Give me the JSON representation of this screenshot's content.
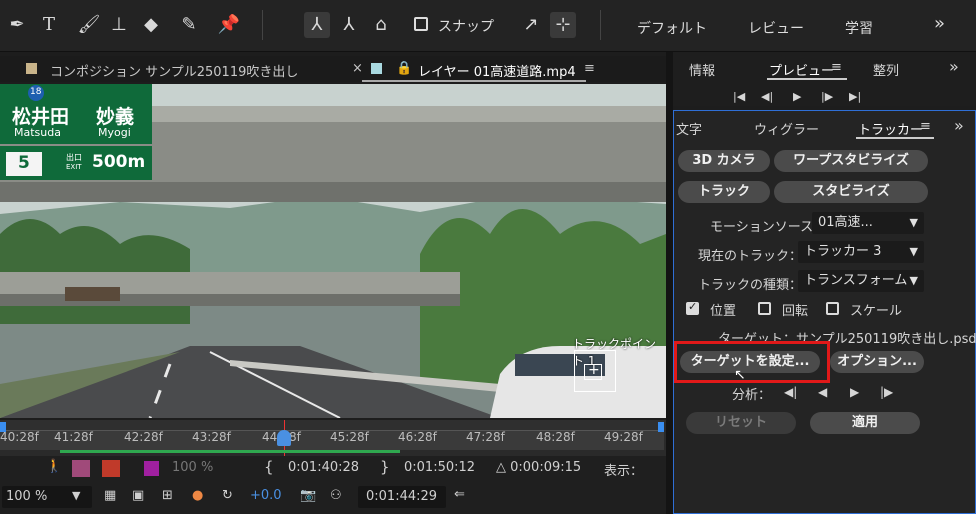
{
  "toolbar": {
    "snap_label": "スナップ",
    "workspaces": [
      "デフォルト",
      "レビュー",
      "学習"
    ],
    "more": "»"
  },
  "comp_panel": {
    "tab1": "コンポジション サンプル250119吹き出し",
    "tab1_close": "×",
    "tab2": "レイヤー 01高速道路.mp4",
    "menu": "≡"
  },
  "viewer": {
    "sign_route": "18",
    "sign_place1": "松井田",
    "sign_place2": "妙義",
    "sign_roman1": "Matsuda",
    "sign_roman2": "Myogi",
    "exit_num": "5",
    "exit_jp": "出口",
    "exit_en": "EXIT",
    "exit_dist": "500m",
    "track_point_label": "トラックポイント 1"
  },
  "timeline": {
    "ticks": [
      "40:28f",
      "41:28f",
      "42:28f",
      "43:28f",
      "44:28f",
      "45:28f",
      "46:28f",
      "47:28f",
      "48:28f",
      "49:28f"
    ]
  },
  "bottom": {
    "opacity": "100 %",
    "in_time": "0:01:40:28",
    "out_time": "0:01:50:12",
    "duration": "△ 0:00:09:15",
    "view_label": "表示：",
    "zoom": "100 %",
    "exposure": "+0.0",
    "current_time": "0:01:44:29"
  },
  "right_top": {
    "tabs": [
      "情報",
      "プレビュー",
      "整列"
    ],
    "menu": "≡"
  },
  "tracker": {
    "tabs": [
      "文字",
      "ウィグラー",
      "トラッカー"
    ],
    "menu": "≡",
    "btn_3d_camera": "3D カメラ",
    "btn_warp": "ワープスタビライズ",
    "btn_track": "トラック",
    "btn_stabilize": "スタビライズ",
    "motion_source_label": "モーションソース：",
    "motion_source_value": "01高速...",
    "current_track_label": "現在のトラック：",
    "current_track_value": "トラッカー 3",
    "track_type_label": "トラックの種類：",
    "track_type_value": "トランスフォーム",
    "cb_position": "位置",
    "cb_rotation": "回転",
    "cb_scale": "スケール",
    "target_text": "ターゲット：サンプル250119吹き出し.psd",
    "btn_set_target": "ターゲットを設定...",
    "btn_options": "オプション...",
    "analyze_label": "分析：",
    "btn_reset": "リセット",
    "btn_apply": "適用",
    "cb_states": {
      "position": true,
      "rotation": false,
      "scale": false
    },
    "highlight_color": "#e11919"
  }
}
